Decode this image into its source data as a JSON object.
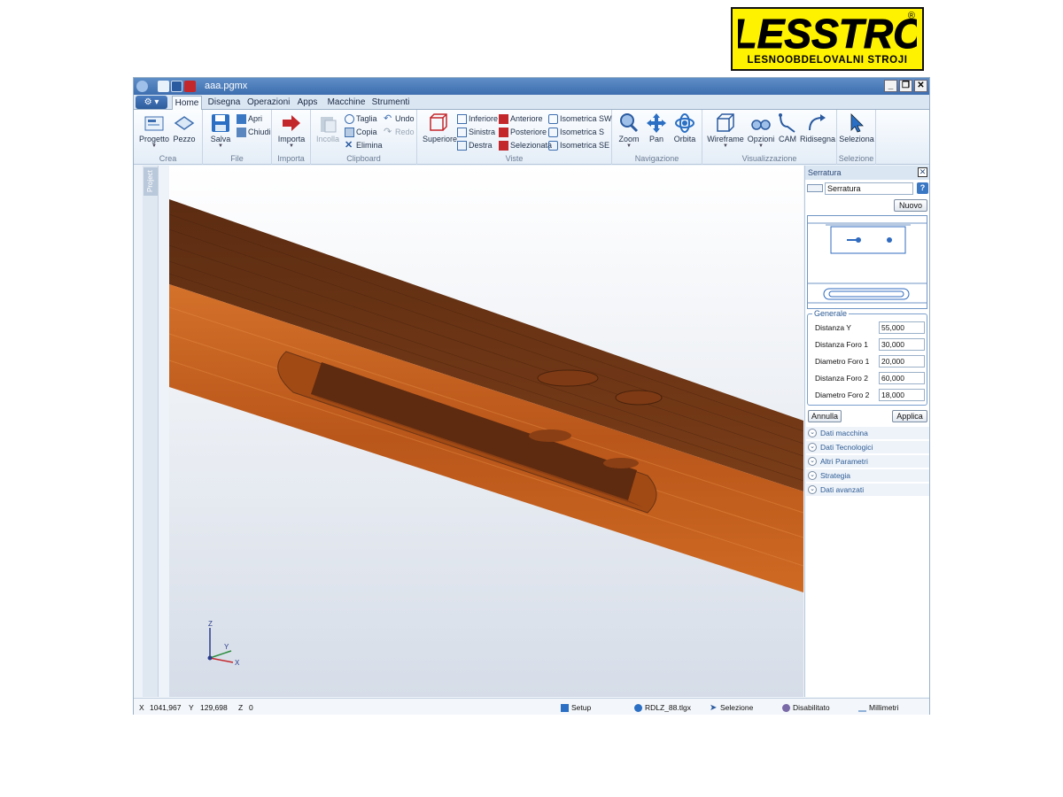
{
  "logo": {
    "brand": "LLESSTROJ",
    "tagline": "LESNOOBDELOVALNI STROJI",
    "reg": "®"
  },
  "window": {
    "title": "aaa.pgmx"
  },
  "tabs": [
    "Home",
    "Disegna",
    "Operazioni",
    "Apps",
    "Macchine",
    "Strumenti"
  ],
  "ribbon": {
    "crea": {
      "label": "Crea",
      "progetto": "Progetto",
      "pezzo": "Pezzo"
    },
    "file": {
      "label": "File",
      "salva": "Salva",
      "apri": "Apri",
      "chiudi": "Chiudi"
    },
    "importa": {
      "label": "Importa",
      "importa": "Importa"
    },
    "clipboard": {
      "label": "Clipboard",
      "incolla": "Incolla",
      "taglia": "Taglia",
      "copia": "Copia",
      "elimina": "Elimina",
      "undo": "Undo",
      "redo": "Redo"
    },
    "viste": {
      "label": "Viste",
      "superiore": "Superiore",
      "inferiore": "Inferiore",
      "sinistra": "Sinistra",
      "destra": "Destra",
      "anteriore": "Anteriore",
      "posteriore": "Posteriore",
      "selezionata": "Selezionata",
      "iso_sw": "Isometrica SW",
      "iso_s": "Isometrica S",
      "iso_se": "Isometrica SE"
    },
    "navigazione": {
      "label": "Navigazione",
      "zoom": "Zoom",
      "pan": "Pan",
      "orbita": "Orbita"
    },
    "visualizzazione": {
      "label": "Visualizzazione",
      "wireframe": "Wireframe",
      "opzioni": "Opzioni",
      "cam": "CAM",
      "ridisegna": "Ridisegna"
    },
    "selezione": {
      "label": "Selezione",
      "seleziona": "Seleziona"
    }
  },
  "left_strip": {
    "project_tab": "Project"
  },
  "axes": {
    "z": "Z",
    "y": "Y",
    "x": "X"
  },
  "panel": {
    "title": "Serratura",
    "selected": "Serratura",
    "help": "?",
    "nuovo": "Nuovo",
    "generale": {
      "legend": "Generale",
      "fields": [
        {
          "label": "Distanza Y",
          "value": "55,000"
        },
        {
          "label": "Distanza Foro 1",
          "value": "30,000"
        },
        {
          "label": "Diametro Foro 1",
          "value": "20,000"
        },
        {
          "label": "Distanza Foro 2",
          "value": "60,000"
        },
        {
          "label": "Diametro Foro 2",
          "value": "18,000"
        }
      ]
    },
    "annulla": "Annulla",
    "applica": "Applica",
    "sections": [
      "Dati macchina",
      "Dati Tecnologici",
      "Altri Parametri",
      "Strategia",
      "Dati avanzati"
    ]
  },
  "status": {
    "x_label": "X",
    "x_value": "1041,967",
    "y_label": "Y",
    "y_value": "129,698",
    "z_label": "Z",
    "z_value": "0",
    "setup": "Setup",
    "tool": "RDLZ_88.tlgx",
    "mode": "Selezione",
    "state": "Disabilitato",
    "units": "Millimetri"
  },
  "colors": {
    "accent": "#3d6eaf",
    "wood_dark": "#6b3516",
    "wood_light": "#c9631f"
  }
}
